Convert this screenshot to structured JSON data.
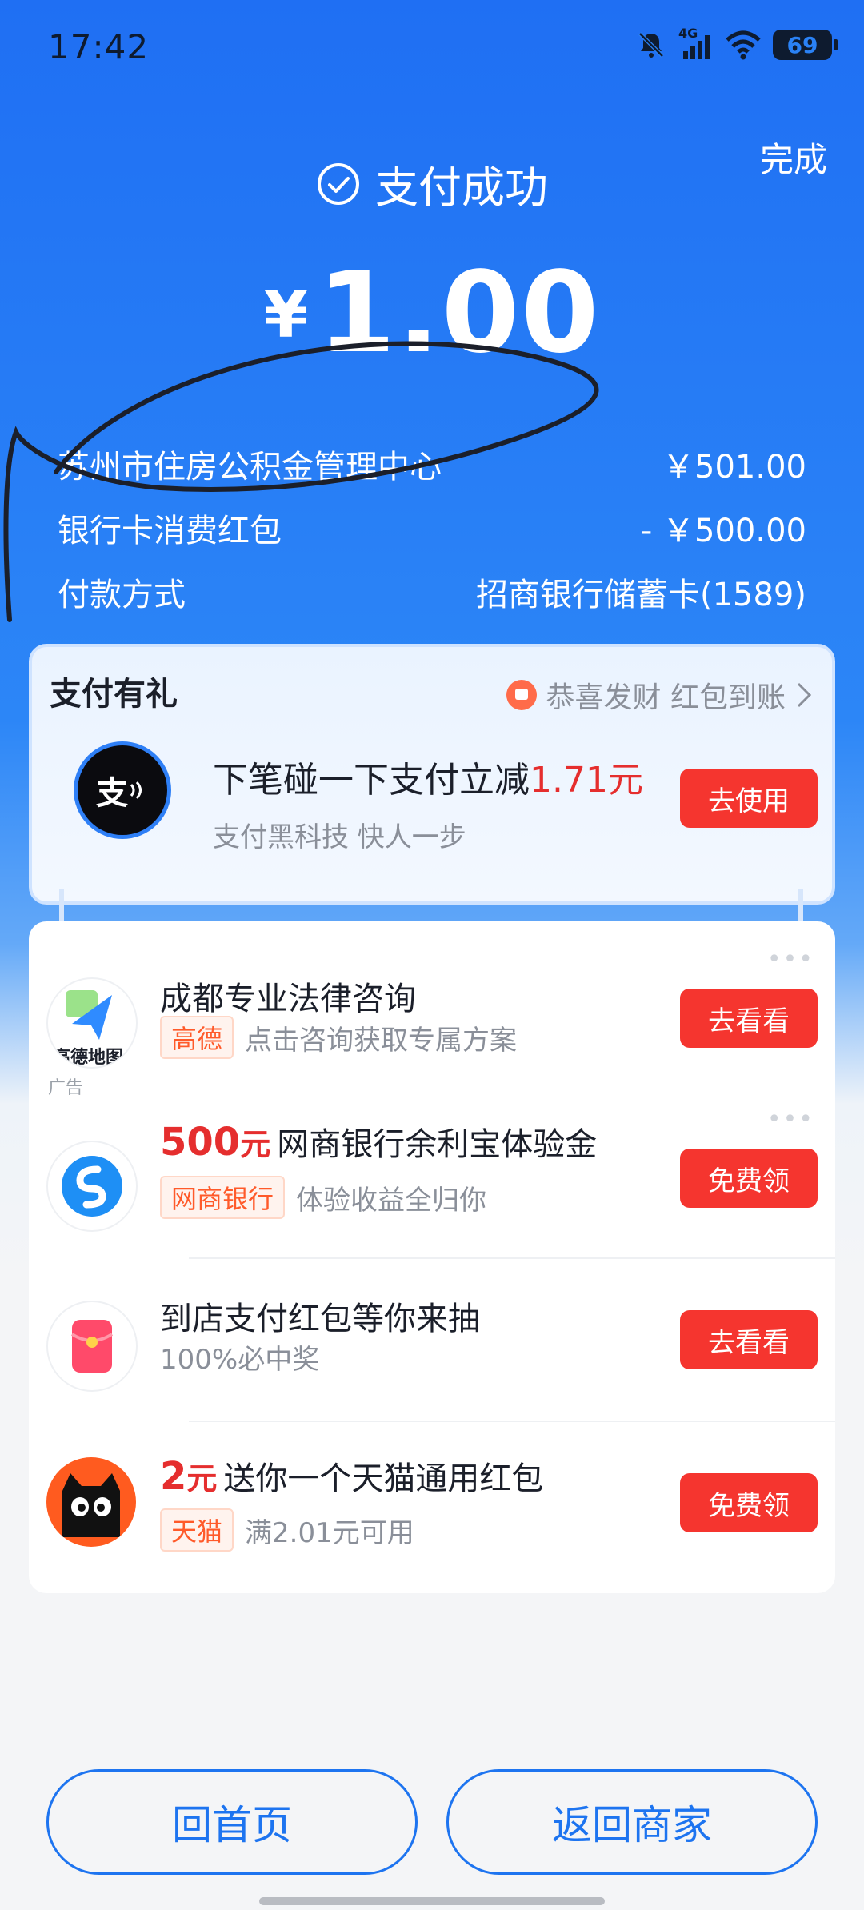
{
  "status_bar": {
    "time": "17:42",
    "battery": "69",
    "network": "4G"
  },
  "header": {
    "done": "完成",
    "status_text": "支付成功",
    "currency": "¥",
    "amount": "1.00"
  },
  "details": [
    {
      "label": "苏州市住房公积金管理中心",
      "value": "￥501.00"
    },
    {
      "label": "银行卡消费红包",
      "value": "- ￥500.00"
    },
    {
      "label": "付款方式",
      "value": "招商银行储蓄卡(1589)"
    }
  ],
  "promo": {
    "title": "支付有礼",
    "congrats": "恭喜发财 红包到账",
    "logo_text": "支",
    "main_text": "下笔碰一下支付立减",
    "main_amount": "1.71元",
    "sub_text": "支付黑科技 快人一步",
    "button": "去使用"
  },
  "list": [
    {
      "title": "成都专业法律咨询",
      "tag": "高德",
      "sub": "点击咨询获取专属方案",
      "button": "去看看",
      "ad_label": "广告",
      "icon_text": "高德地图"
    },
    {
      "amount": "500",
      "unit": "元",
      "title": "网商银行余利宝体验金",
      "tag": "网商银行",
      "sub": "体验收益全归你",
      "button": "免费领"
    },
    {
      "title": "到店支付红包等你来抽",
      "sub": "100%必中奖",
      "button": "去看看"
    },
    {
      "amount": "2",
      "unit": "元",
      "title": "送你一个天猫通用红包",
      "tag": "天猫",
      "sub": "满2.01元可用",
      "button": "免费领"
    }
  ],
  "bottom": {
    "home": "回首页",
    "back_merchant": "返回商家"
  },
  "colors": {
    "primary_blue": "#2478f2",
    "accent_red": "#f5352f"
  }
}
